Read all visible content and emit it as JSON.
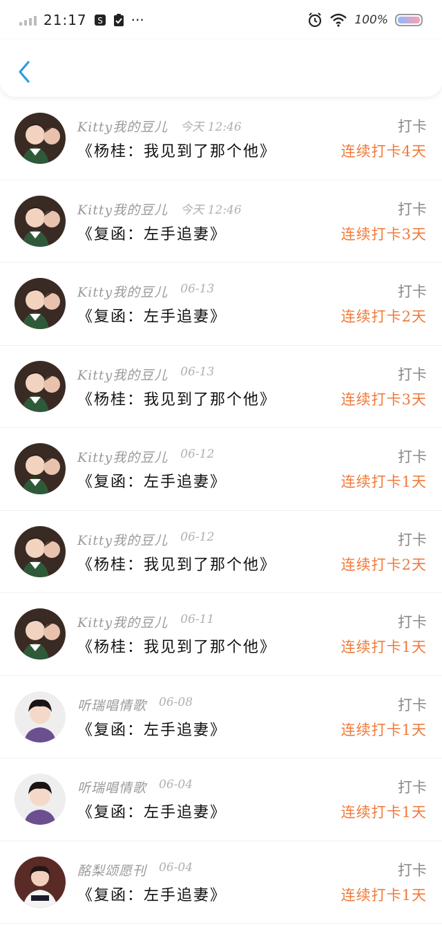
{
  "status_bar": {
    "time": "21:17",
    "battery": "100%",
    "icons": [
      "signal-icon",
      "sync-icon",
      "clipboard-icon",
      "more-icon",
      "alarm-icon",
      "wifi-icon",
      "battery-icon"
    ],
    "more": "···"
  },
  "header": {
    "back_icon": "chevron-left-icon"
  },
  "colors": {
    "accent_blue": "#2d9cdb",
    "streak_orange": "#f07a3a",
    "secondary_gray": "#9a9a9a"
  },
  "list": [
    {
      "name": "Kitty我的豆儿",
      "date": "今天 12:46",
      "title": "《杨桂：我见到了那个他》",
      "action": "打卡",
      "streak": "连续打卡4天",
      "avatar": "a"
    },
    {
      "name": "Kitty我的豆儿",
      "date": "今天 12:46",
      "title": "《复函：左手追妻》",
      "action": "打卡",
      "streak": "连续打卡3天",
      "avatar": "a"
    },
    {
      "name": "Kitty我的豆儿",
      "date": "06-13",
      "title": "《复函：左手追妻》",
      "action": "打卡",
      "streak": "连续打卡2天",
      "avatar": "a"
    },
    {
      "name": "Kitty我的豆儿",
      "date": "06-13",
      "title": "《杨桂：我见到了那个他》",
      "action": "打卡",
      "streak": "连续打卡3天",
      "avatar": "a"
    },
    {
      "name": "Kitty我的豆儿",
      "date": "06-12",
      "title": "《复函：左手追妻》",
      "action": "打卡",
      "streak": "连续打卡1天",
      "avatar": "a"
    },
    {
      "name": "Kitty我的豆儿",
      "date": "06-12",
      "title": "《杨桂：我见到了那个他》",
      "action": "打卡",
      "streak": "连续打卡2天",
      "avatar": "a"
    },
    {
      "name": "Kitty我的豆儿",
      "date": "06-11",
      "title": "《杨桂：我见到了那个他》",
      "action": "打卡",
      "streak": "连续打卡1天",
      "avatar": "a"
    },
    {
      "name": "听瑞唱情歌",
      "date": "06-08",
      "title": "《复函：左手追妻》",
      "action": "打卡",
      "streak": "连续打卡1天",
      "avatar": "b"
    },
    {
      "name": "听瑞唱情歌",
      "date": "06-04",
      "title": "《复函：左手追妻》",
      "action": "打卡",
      "streak": "连续打卡1天",
      "avatar": "b"
    },
    {
      "name": "酩梨颂愿刊",
      "date": "06-04",
      "title": "《复函：左手追妻》",
      "action": "打卡",
      "streak": "连续打卡1天",
      "avatar": "c"
    }
  ]
}
